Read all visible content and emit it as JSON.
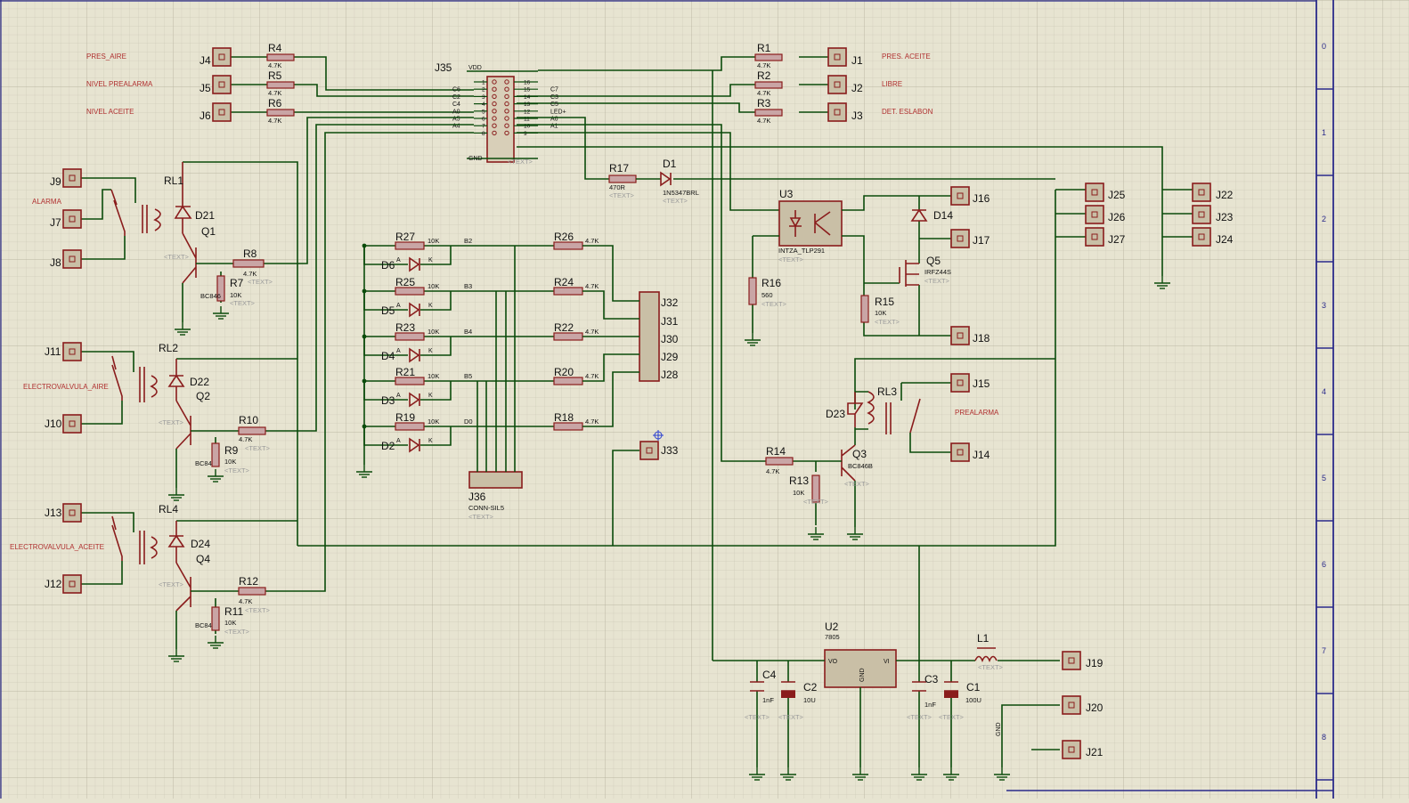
{
  "nets": {
    "pres_aire": "PRES_AIRE",
    "nivel_prealarma": "NIVEL PREALARMA",
    "nivel_aceite": "NIVEL ACEITE",
    "pres_aceite": "PRES. ACEITE",
    "libre": "LIBRE",
    "det_eslabon": "DET. ESLABON",
    "alarma": "ALARMA",
    "ev_aire": "ELECTROVALVULA_AIRE",
    "ev_aceite": "ELECTROVALVULA_ACEITE",
    "prealarma": "PREALARMA",
    "gnd": "GND"
  },
  "placeholder": "<TEXT>",
  "j35": {
    "ref": "J35",
    "vdd": "VDD",
    "gnd": "GND",
    "ph": "<TEXT>",
    "left": [
      {
        "n": "1",
        "s": ""
      },
      {
        "n": "2",
        "s": "C6"
      },
      {
        "n": "3",
        "s": "C2"
      },
      {
        "n": "4",
        "s": "C4"
      },
      {
        "n": "5",
        "s": "A0"
      },
      {
        "n": "6",
        "s": "A5"
      },
      {
        "n": "7",
        "s": "A4"
      },
      {
        "n": "8",
        "s": ""
      }
    ],
    "right": [
      {
        "n": "16",
        "s": ""
      },
      {
        "n": "15",
        "s": "C7"
      },
      {
        "n": "14",
        "s": "C3"
      },
      {
        "n": "13",
        "s": "C5"
      },
      {
        "n": "12",
        "s": "LED+"
      },
      {
        "n": "11",
        "s": "A6"
      },
      {
        "n": "10",
        "s": "A1"
      },
      {
        "n": "9",
        "s": ""
      }
    ]
  },
  "connectors": {
    "J4": "J4",
    "J5": "J5",
    "J6": "J6",
    "J1": "J1",
    "J2": "J2",
    "J3": "J3",
    "J9": "J9",
    "J7": "J7",
    "J8": "J8",
    "J11": "J11",
    "J10": "J10",
    "J13": "J13",
    "J12": "J12",
    "J16": "J16",
    "J17": "J17",
    "J18": "J18",
    "J15": "J15",
    "J14": "J14",
    "J25": "J25",
    "J26": "J26",
    "J27": "J27",
    "J22": "J22",
    "J23": "J23",
    "J24": "J24",
    "J32": "J32",
    "J31": "J31",
    "J30": "J30",
    "J29": "J29",
    "J28": "J28",
    "J33": "J33",
    "J19": "J19",
    "J20": "J20",
    "J21": "J21"
  },
  "resistors": {
    "R4": {
      "ref": "R4",
      "val": "4.7K"
    },
    "R5": {
      "ref": "R5",
      "val": "4.7K"
    },
    "R6": {
      "ref": "R6",
      "val": "4.7K"
    },
    "R1": {
      "ref": "R1",
      "val": "4.7K"
    },
    "R2": {
      "ref": "R2",
      "val": "4.7K"
    },
    "R3": {
      "ref": "R3",
      "val": "4.7K"
    },
    "R17": {
      "ref": "R17",
      "val": "470R"
    },
    "R8": {
      "ref": "R8",
      "val": "4.7K"
    },
    "R7": {
      "ref": "R7",
      "val": "10K"
    },
    "R10": {
      "ref": "R10",
      "val": "4.7K"
    },
    "R9": {
      "ref": "R9",
      "val": "10K"
    },
    "R12": {
      "ref": "R12",
      "val": "4.7K"
    },
    "R11": {
      "ref": "R11",
      "val": "10K"
    },
    "R27": {
      "ref": "R27",
      "val": "10K"
    },
    "R25": {
      "ref": "R25",
      "val": "10K"
    },
    "R23": {
      "ref": "R23",
      "val": "10K"
    },
    "R21": {
      "ref": "R21",
      "val": "10K"
    },
    "R19": {
      "ref": "R19",
      "val": "10K"
    },
    "R26": {
      "ref": "R26",
      "val": "4.7K"
    },
    "R24": {
      "ref": "R24",
      "val": "4.7K"
    },
    "R22": {
      "ref": "R22",
      "val": "4.7K"
    },
    "R20": {
      "ref": "R20",
      "val": "4.7K"
    },
    "R18": {
      "ref": "R18",
      "val": "4.7K"
    },
    "R16": {
      "ref": "R16",
      "val": "560"
    },
    "R15": {
      "ref": "R15",
      "val": "10K"
    },
    "R14": {
      "ref": "R14",
      "val": "4.7K"
    },
    "R13": {
      "ref": "R13",
      "val": "10K"
    }
  },
  "bus_labels": {
    "B2": "B2",
    "B3": "B3",
    "B4": "B4",
    "B5": "B5",
    "D0": "D0"
  },
  "diodes": {
    "D1": {
      "ref": "D1",
      "val": "1N5347BRL"
    },
    "D21": "D21",
    "D22": "D22",
    "D24": "D24",
    "D23": "D23",
    "D14": "D14",
    "D6": "D6",
    "D5": "D5",
    "D4": "D4",
    "D3": "D3",
    "D2": "D2"
  },
  "relays": {
    "RL1": "RL1",
    "RL2": "RL2",
    "RL4": "RL4",
    "RL3": "RL3"
  },
  "transistors": {
    "Q1": {
      "ref": "Q1",
      "val": "BC846"
    },
    "Q2": {
      "ref": "Q2",
      "val": "BC84"
    },
    "Q4": {
      "ref": "Q4",
      "val": "BC84"
    },
    "Q3": {
      "ref": "Q3",
      "val": "BC846B"
    },
    "Q5": {
      "ref": "Q5",
      "val": "IRFZ44S"
    }
  },
  "u3": {
    "ref": "U3",
    "val": "INTZA_TLP291"
  },
  "u2": {
    "ref": "U2",
    "val": "7805",
    "vo": "VO",
    "vi": "VI",
    "gnd": "GND"
  },
  "j36": {
    "ref": "J36",
    "val": "CONN-SIL5"
  },
  "caps": {
    "C4": {
      "ref": "C4",
      "val": "1nF"
    },
    "C2": {
      "ref": "C2",
      "val": "10U"
    },
    "C3": {
      "ref": "C3",
      "val": "1nF"
    },
    "C1": {
      "ref": "C1",
      "val": "100U"
    }
  },
  "l1": {
    "ref": "L1"
  },
  "border_marks": [
    "0",
    "1",
    "2",
    "3",
    "4",
    "5",
    "6",
    "7",
    "8"
  ],
  "pin_one": "1"
}
